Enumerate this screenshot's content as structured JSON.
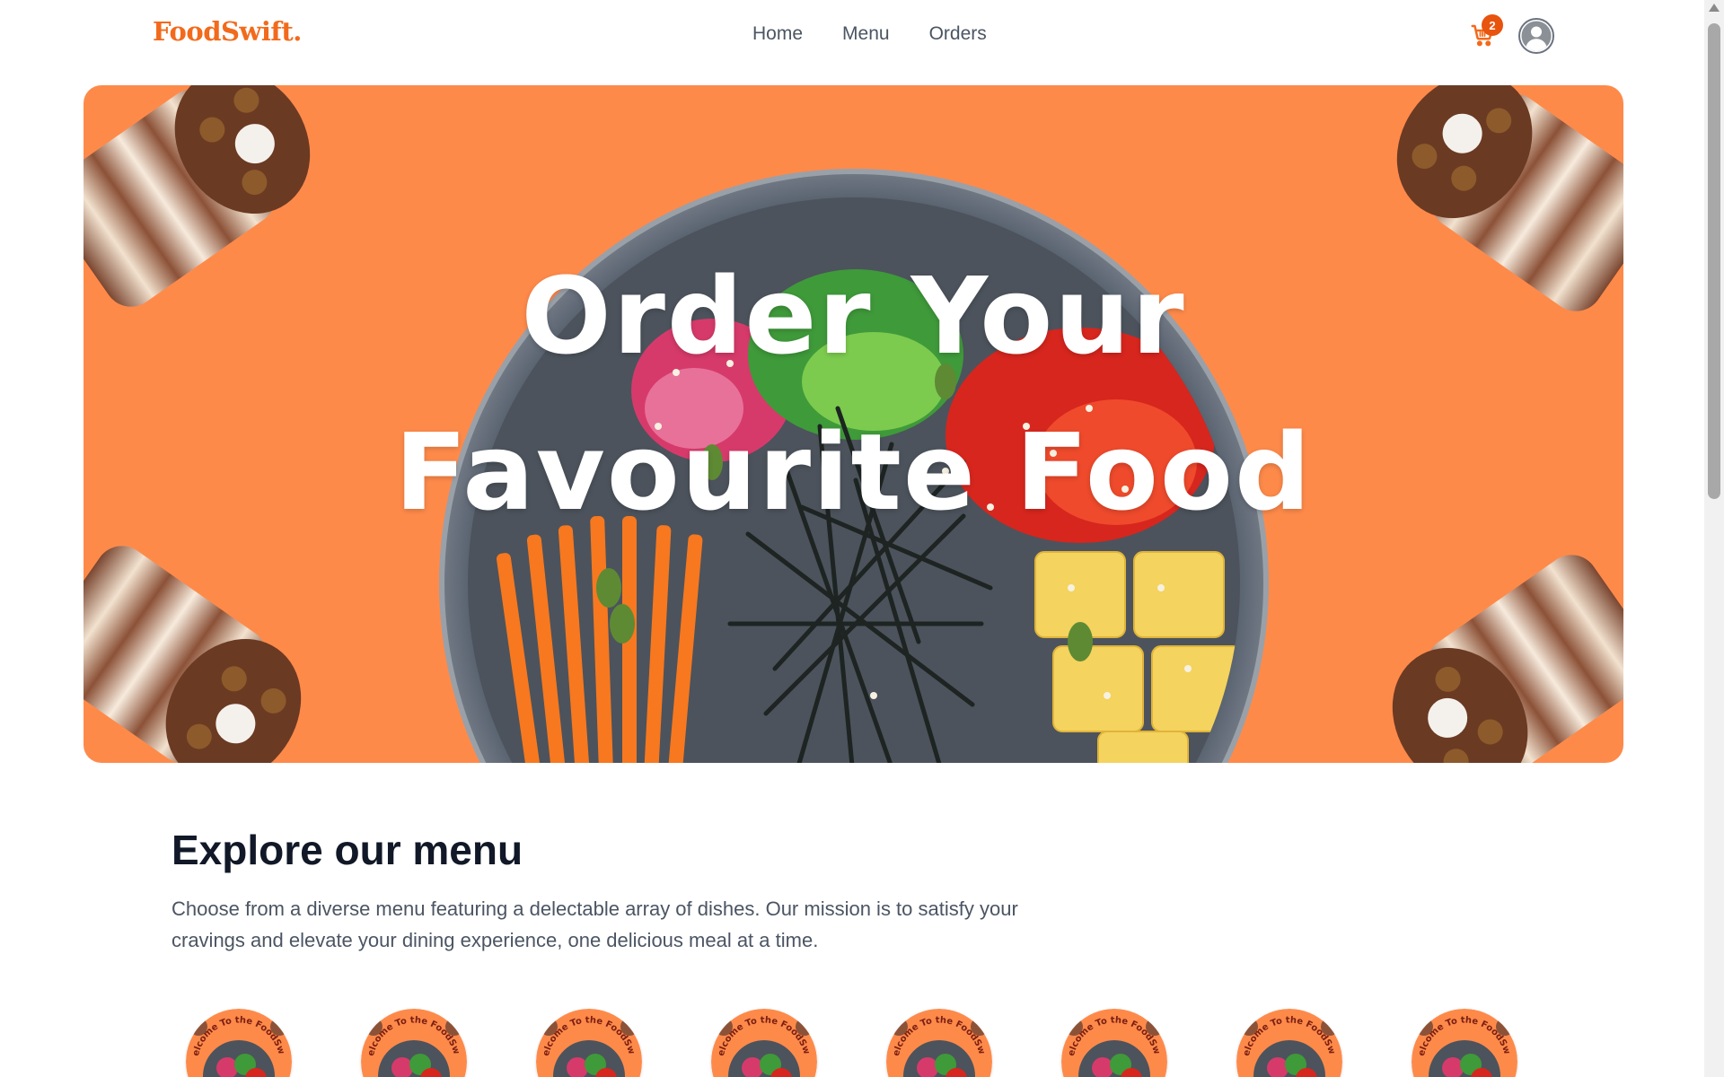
{
  "navbar": {
    "logo": "FoodSwift.",
    "links": [
      "Home",
      "Menu",
      "Orders"
    ],
    "cart_count": "2",
    "cart_icon": "cart-icon",
    "profile_icon": "user-avatar-icon"
  },
  "hero": {
    "title_line1": "Order Your",
    "title_line2": "Favourite Food",
    "background_color": "#fe8a4a"
  },
  "explore": {
    "title": "Explore our menu",
    "description": "Choose from a diverse menu featuring a delectable array of dishes. Our mission is to satisfy your cravings and elevate your dining experience, one delicious meal at a time.",
    "item_badge_text": "Welcome To the FoodSwift · Get Delivery At time",
    "items_count": 8
  },
  "colors": {
    "brand": "#f26a1b",
    "hero_bg": "#fe8a4a",
    "heading": "#111827",
    "muted": "#4b5563"
  }
}
